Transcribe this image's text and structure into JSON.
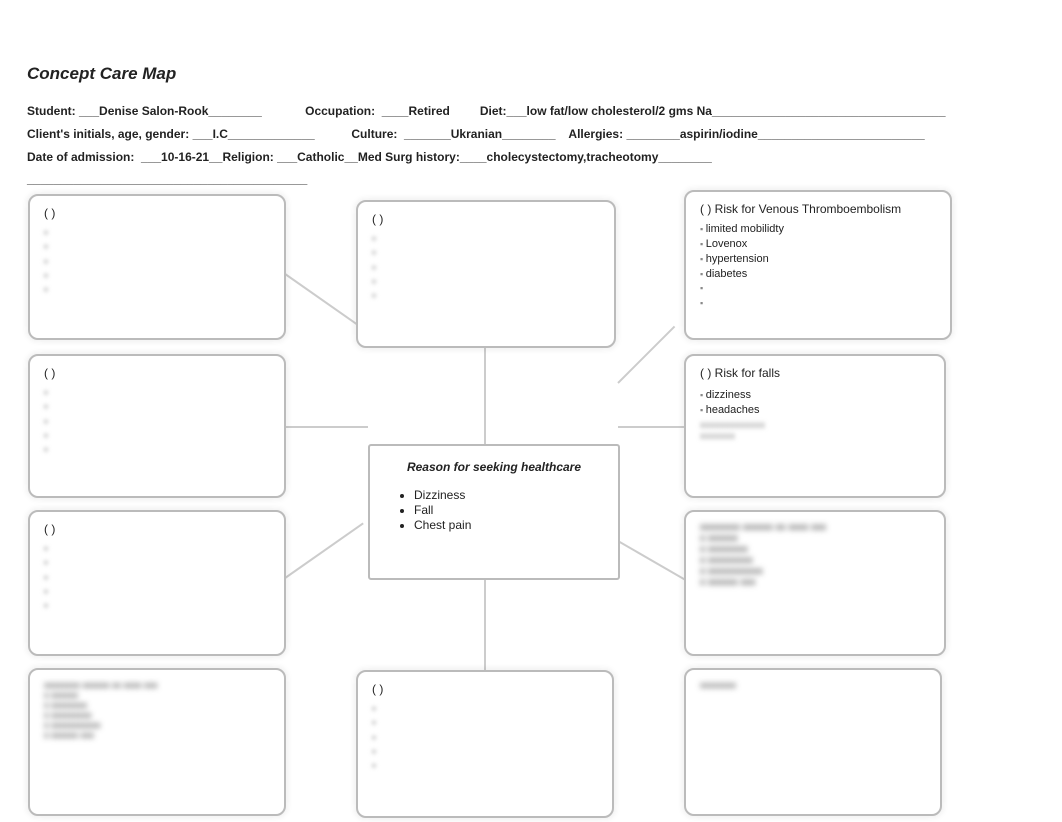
{
  "title": "Concept Care Map",
  "header": {
    "student_label": "Student: ",
    "student_value": "___Denise Salon-Rook________",
    "occupation_label": "Occupation:  ",
    "occupation_value": "____Retired",
    "diet_label": "Diet:",
    "diet_value": "___low fat/low cholesterol/2 gms Na___________________________________",
    "client_label": "Client's initials, age, gender: ",
    "client_value": "___I.C_____________",
    "culture_label": "Culture:  ",
    "culture_value": "_______Ukranian________",
    "allergies_label": "Allergies: ",
    "allergies_value": "________aspirin/iodine_________________________",
    "doa_label": "Date of admission:  ",
    "doa_value": "___10-16-21__",
    "religion_label": "Religion: ",
    "religion_value": "___Catholic__",
    "medsurg_label": "Med Surg history:",
    "medsurg_value": "____cholecystectomy,tracheotomy________",
    "filler_line": "__________________________________________"
  },
  "center": {
    "title": "Reason for seeking healthcare",
    "items": [
      "Dizziness",
      "Fall",
      "Chest pain"
    ]
  },
  "boxes": {
    "left1_label": "(   )",
    "left2_label": "(   )",
    "left3_label": "(   )",
    "mid_top_label": "(   )",
    "mid_bot_label": "(   )",
    "r1_label": "(   )  Risk for Venous  Thromboembolism",
    "r1_items": [
      " limited mobilidty",
      "Lovenox",
      "hypertension",
      "diabetes",
      "",
      ""
    ],
    "r2_label": "(   )  Risk for falls",
    "r2_items": [
      "dizziness",
      "headaches"
    ],
    "blur_placeholder": "xxxxxxxx xxxxxx xx xxxx xxx\nx xxxxxx\nx xxxxxxxx\nx xxxxxxxxx\nx xxxxxxxxxxx\nx xxxxxx xxx",
    "blank_bullets": "▪\n▪\n▪\n▪\n▪"
  }
}
